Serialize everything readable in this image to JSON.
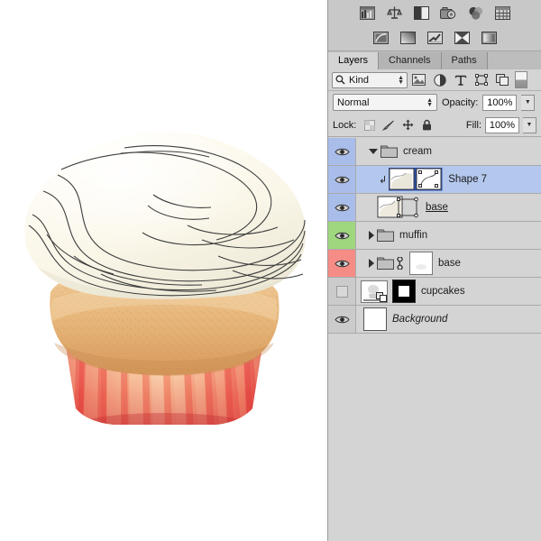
{
  "app": {
    "title": "Photoshop Layers Panel",
    "accent_selection": "#b4c8ee",
    "panel_bg": "#d4d4d4"
  },
  "icon_strip": {
    "row1": [
      {
        "name": "histogram-icon",
        "label": "Histogram"
      },
      {
        "name": "info-icon",
        "label": "Info"
      },
      {
        "name": "adjustments-icon",
        "label": "Adjustments"
      },
      {
        "name": "camera-raw-icon",
        "label": "Camera Raw"
      },
      {
        "name": "color-icon",
        "label": "Color"
      },
      {
        "name": "swatches-icon",
        "label": "Swatches"
      }
    ],
    "row2": [
      {
        "name": "styles-icon",
        "label": "Styles"
      },
      {
        "name": "gradient-icon",
        "label": "Gradient"
      },
      {
        "name": "brush-presets-icon",
        "label": "Brush Presets"
      },
      {
        "name": "mask-icon",
        "label": "Masks"
      },
      {
        "name": "properties-icon",
        "label": "Properties"
      }
    ]
  },
  "tabs": [
    {
      "label": "Layers",
      "active": true
    },
    {
      "label": "Channels",
      "active": false
    },
    {
      "label": "Paths",
      "active": false
    }
  ],
  "filter": {
    "search_icon": "search-icon",
    "kind_label": "Kind",
    "buttons": [
      {
        "name": "filter-pixel-icon",
        "label": "Pixel Layers"
      },
      {
        "name": "filter-adjustment-icon",
        "label": "Adjustment Layers"
      },
      {
        "name": "filter-type-icon",
        "label": "Type Layers"
      },
      {
        "name": "filter-shape-icon",
        "label": "Shape Layers"
      },
      {
        "name": "filter-smart-object-icon",
        "label": "Smart Objects"
      }
    ],
    "toggle_label": "Filter On/Off"
  },
  "blend": {
    "mode": "Normal",
    "opacity_label": "Opacity:",
    "opacity_value": "100%",
    "fill_label": "Fill:",
    "fill_value": "100%"
  },
  "lock": {
    "label": "Lock:",
    "icons": [
      {
        "name": "lock-transparency-icon",
        "label": "Lock transparent pixels"
      },
      {
        "name": "lock-image-icon",
        "label": "Lock image pixels"
      },
      {
        "name": "lock-position-icon",
        "label": "Lock position"
      },
      {
        "name": "lock-all-icon",
        "label": "Lock all"
      }
    ]
  },
  "layers": [
    {
      "name": "cream",
      "type": "group",
      "expanded": true,
      "visible": true,
      "eye_color": "blue",
      "row_selected": false,
      "indent": 0,
      "italic": false,
      "editing": false,
      "clipped": false,
      "linked": false,
      "thumbnail": "none"
    },
    {
      "name": "Shape 7",
      "type": "shape",
      "expanded": null,
      "visible": true,
      "eye_color": "blue",
      "row_selected": true,
      "indent": 1,
      "italic": false,
      "editing": false,
      "clipped": true,
      "linked": false,
      "thumbnail": "shape-vector"
    },
    {
      "name": "base",
      "type": "shape",
      "expanded": null,
      "visible": true,
      "eye_color": "blue",
      "row_selected": false,
      "indent": 1,
      "italic": false,
      "editing": true,
      "clipped": false,
      "linked": false,
      "thumbnail": "shape-vector"
    },
    {
      "name": "muffin",
      "type": "group",
      "expanded": false,
      "visible": true,
      "eye_color": "green",
      "row_selected": false,
      "indent": 0,
      "italic": false,
      "editing": false,
      "clipped": false,
      "linked": false,
      "thumbnail": "none"
    },
    {
      "name": "base",
      "type": "group",
      "expanded": false,
      "visible": true,
      "eye_color": "red",
      "row_selected": false,
      "indent": 0,
      "italic": false,
      "editing": false,
      "clipped": false,
      "linked": true,
      "thumbnail": "white-mask"
    },
    {
      "name": "cupcakes",
      "type": "smart-object",
      "expanded": null,
      "visible": false,
      "eye_color": "gray",
      "row_selected": false,
      "indent": 0,
      "italic": false,
      "editing": false,
      "clipped": false,
      "linked": false,
      "thumbnail": "smart-object-plus-mask"
    },
    {
      "name": "Background",
      "type": "background",
      "expanded": null,
      "visible": true,
      "eye_color": "gray",
      "row_selected": false,
      "indent": 0,
      "italic": true,
      "editing": false,
      "clipped": false,
      "linked": false,
      "thumbnail": "white"
    }
  ],
  "canvas": {
    "artwork": "cupcake-illustration",
    "description": "Cupcake with white swirled cream frosting, golden muffin top and a red-orange striped paper wrapper",
    "colors": {
      "cream": "#fbf8ee",
      "cream_shadow": "#e8e4d3",
      "muffin": "#e8bb83",
      "muffin_dark": "#cf9b5d",
      "wrapper_red": "#ef4a47",
      "wrapper_light": "#fbd9a4",
      "wrapper_mid": "#f4866a",
      "path_stroke": "#3a3a3a"
    }
  }
}
